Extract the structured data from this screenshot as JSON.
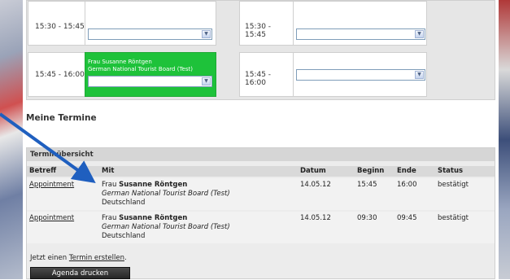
{
  "grid": {
    "rows": [
      {
        "left": {
          "time": "15:30 - 15:45",
          "booked": false,
          "name": "",
          "org": ""
        },
        "right": {
          "time": "15:30 - 15:45"
        }
      },
      {
        "left": {
          "time": "15:45 - 16:00",
          "booked": true,
          "name": "Frau Susanne Röntgen",
          "org": "German National Tourist Board (Test)"
        },
        "right": {
          "time": "15:45 - 16:00"
        }
      }
    ]
  },
  "section": {
    "title": "Meine Termine"
  },
  "panel": {
    "title": "Terminübersicht",
    "columns": [
      "Betreff",
      "Mit",
      "Datum",
      "Beginn",
      "Ende",
      "Status"
    ],
    "rows": [
      {
        "subject": "Appointment",
        "salutation": "Frau",
        "name": "Susanne Röntgen",
        "org": "German National Tourist Board (Test)",
        "country": "Deutschland",
        "date": "14.05.12",
        "start": "15:45",
        "end": "16:00",
        "status": "bestätigt"
      },
      {
        "subject": "Appointment",
        "salutation": "Frau",
        "name": "Susanne Röntgen",
        "org": "German National Tourist Board (Test)",
        "country": "Deutschland",
        "date": "14.05.12",
        "start": "09:30",
        "end": "09:45",
        "status": "bestätigt"
      }
    ],
    "create_prefix": "Jetzt einen",
    "create_link": "Termin erstellen",
    "create_suffix": ".",
    "print_button": "Agenda drucken"
  },
  "colors": {
    "booked": "#1ec23a",
    "annotation_arrow": "#1f5fbf"
  }
}
